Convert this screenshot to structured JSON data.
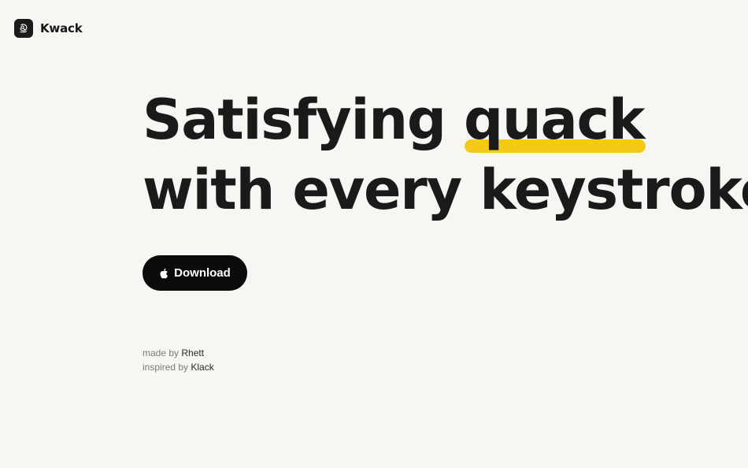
{
  "brand": {
    "name": "Kwack",
    "logo_icon": "duck-icon"
  },
  "hero": {
    "line1_prefix": "Satisfying ",
    "line1_highlight": "quack",
    "line2": "with every keystroke",
    "highlight_color": "#f5c917"
  },
  "download_button": {
    "label": "Download",
    "icon": "apple-icon"
  },
  "credits": {
    "made_by_label": "made by",
    "made_by_name": "Rhett",
    "inspired_by_label": "inspired by",
    "inspired_by_name": "Klack"
  }
}
